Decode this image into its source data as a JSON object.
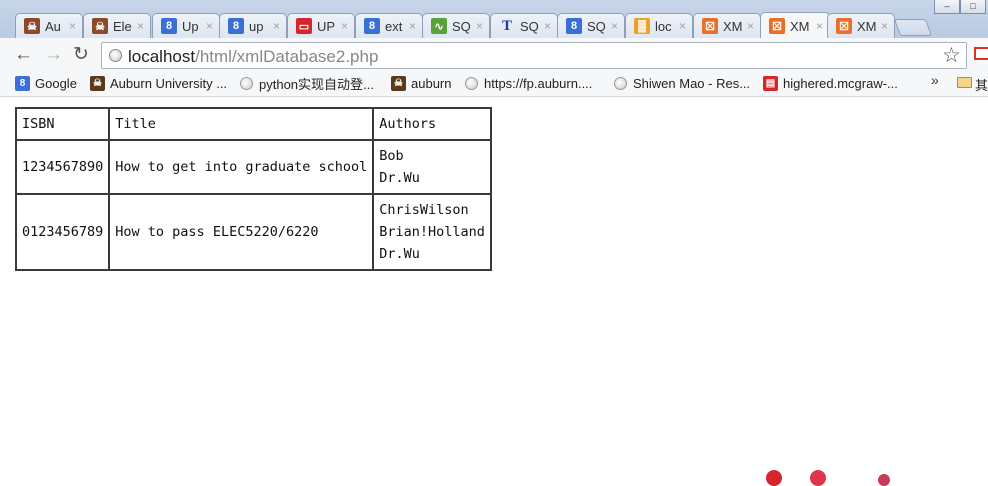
{
  "tabs": [
    {
      "title": "Au",
      "color": "#8a4b2a",
      "glyph": "☠"
    },
    {
      "title": "Ele",
      "color": "#8a4b2a",
      "glyph": "☠"
    },
    {
      "title": "Up",
      "color": "#3b6fd8",
      "glyph": "8"
    },
    {
      "title": "up",
      "color": "#3b6fd8",
      "glyph": "8"
    },
    {
      "title": "UP",
      "color": "#d6262b",
      "glyph": "▭"
    },
    {
      "title": "ext",
      "color": "#3b6fd8",
      "glyph": "8"
    },
    {
      "title": "SQ",
      "color": "#5aa03c",
      "glyph": "∿"
    },
    {
      "title": "SQ",
      "color": "#ffffff",
      "glyph": "T"
    },
    {
      "title": "SQ",
      "color": "#3b6fd8",
      "glyph": "8"
    },
    {
      "title": "loc",
      "color": "#f0a020",
      "glyph": "▓"
    },
    {
      "title": "XM",
      "color": "#e8702a",
      "glyph": "☒"
    },
    {
      "title": "XM",
      "color": "#e8702a",
      "glyph": "☒"
    },
    {
      "title": "XM",
      "color": "#e8702a",
      "glyph": "☒"
    }
  ],
  "close_glyph": "×",
  "window": {
    "minimize": "–",
    "maximize": "□"
  },
  "nav": {
    "back": "←",
    "forward": "→",
    "reload": "↻"
  },
  "address": {
    "host": "localhost",
    "path": "/html/xmlDatabase2.php"
  },
  "bookmark_star": "☆",
  "bookmarks": [
    {
      "label": "Google",
      "icon": "g",
      "color": "#3b6fd8",
      "glyph": "8"
    },
    {
      "label": "Auburn University ...",
      "icon": "tiger",
      "color": "#5a3a1a",
      "glyph": "☠"
    },
    {
      "label": "python实现自动登...",
      "icon": "globe"
    },
    {
      "label": "auburn",
      "icon": "tiger",
      "color": "#5a3a1a",
      "glyph": "☠"
    },
    {
      "label": "https://fp.auburn....",
      "icon": "globe"
    },
    {
      "label": "Shiwen Mao - Res...",
      "icon": "globe"
    },
    {
      "label": "highered.mcgraw-...",
      "icon": "mcgraw",
      "color": "#d6262b",
      "glyph": "▤"
    }
  ],
  "bookmarks_overflow": "»",
  "other_bookmarks": "其",
  "table": {
    "headers": [
      "ISBN",
      "Title",
      "Authors"
    ],
    "rows": [
      {
        "isbn": "1234567890",
        "title": "How to get into graduate school",
        "authors": [
          "Bob",
          "Dr.Wu"
        ]
      },
      {
        "isbn": "0123456789",
        "title": "How to pass ELEC5220/6220",
        "authors": [
          "ChrisWilson",
          "Brian!Holland",
          "Dr.Wu"
        ]
      }
    ]
  }
}
